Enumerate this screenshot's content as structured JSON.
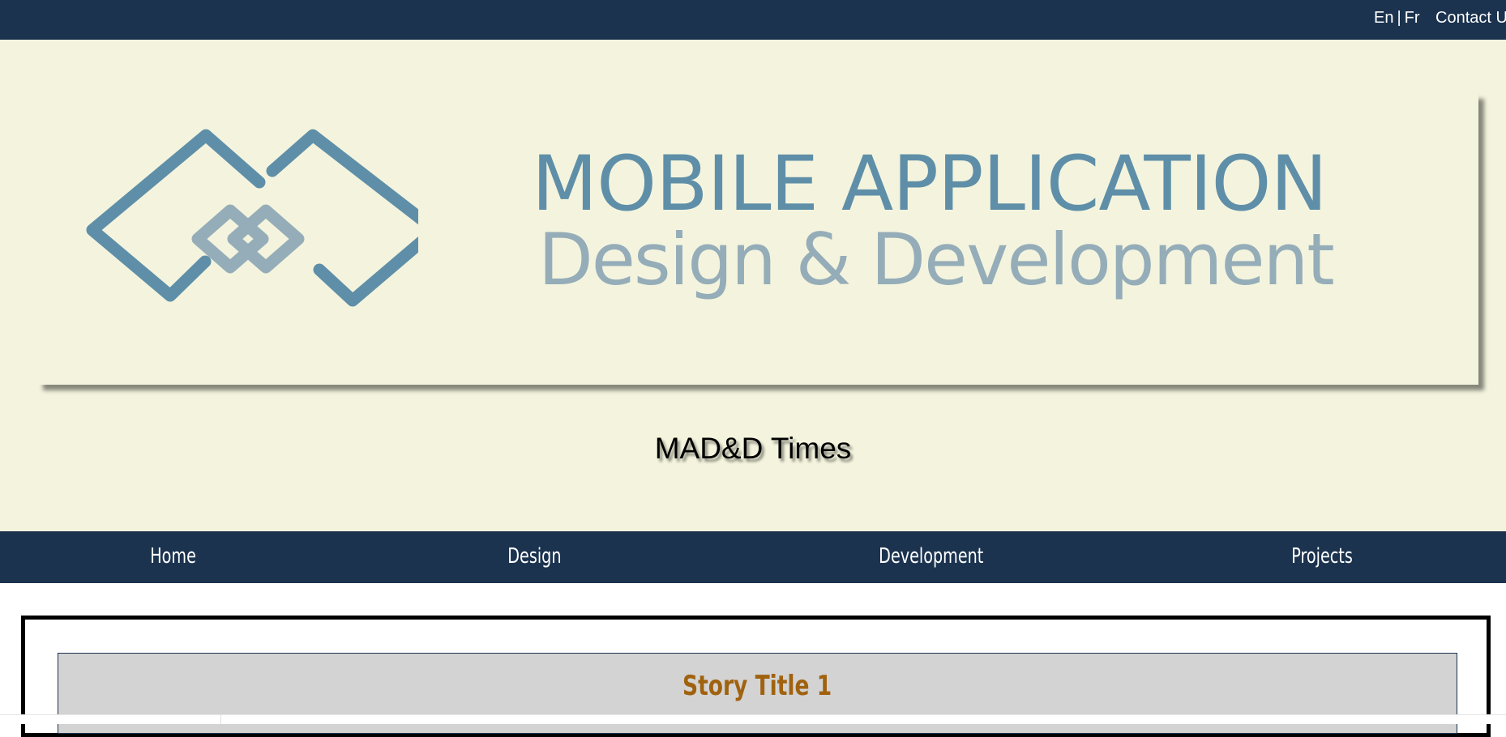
{
  "topbar": {
    "lang_en": "En",
    "lang_sep": "|",
    "lang_fr": "Fr",
    "contact": "Contact Us"
  },
  "banner": {
    "line1": "MOBILE APPLICATION",
    "line2": "Design & Development",
    "logo_icon": "interlocking-diamonds-icon"
  },
  "site_title": "MAD&D Times",
  "nav": {
    "home": "Home",
    "design": "Design",
    "development": "Development",
    "projects": "Projects"
  },
  "content": {
    "stories": [
      {
        "title": "Story Title 1"
      }
    ]
  },
  "colors": {
    "navy": "#1b334f",
    "cream": "#f4f4de",
    "logo_blue": "#5f8fa8",
    "logo_gray": "#95adb8",
    "link_orange": "#a0620f",
    "card_gray": "#d3d3d3"
  }
}
